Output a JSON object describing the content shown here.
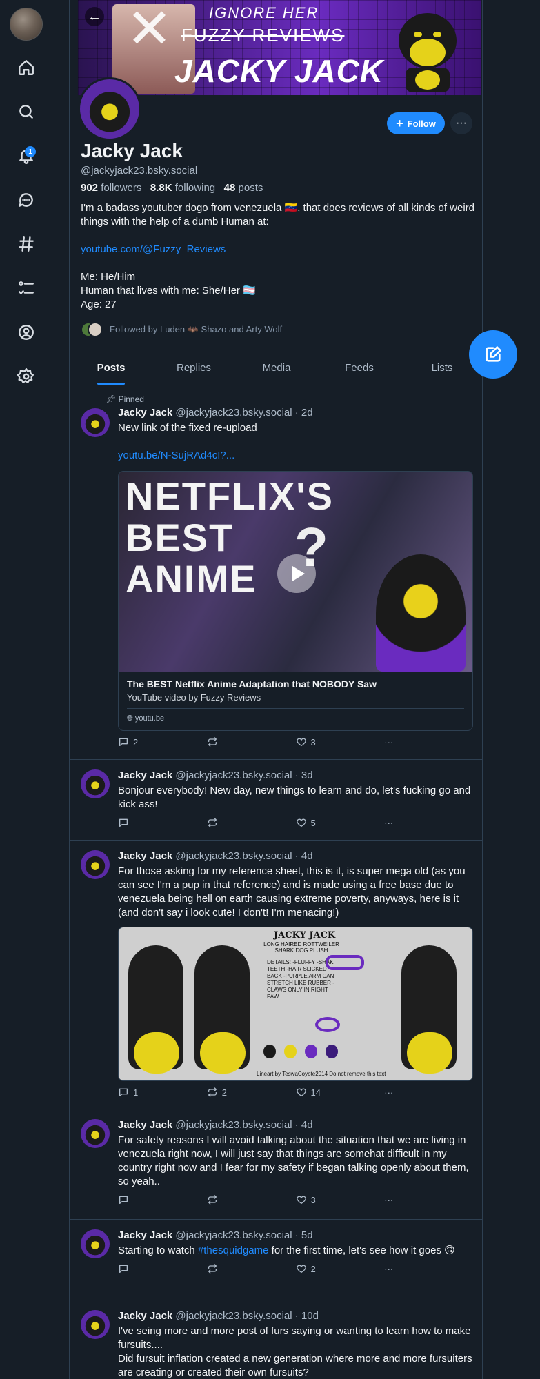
{
  "rail": {
    "notif_count": "1",
    "icons": [
      "home-icon",
      "search-icon",
      "bell-icon",
      "chat-icon",
      "hashtag-icon",
      "list-icon",
      "profile-icon",
      "settings-icon"
    ]
  },
  "banner": {
    "line1": "IGNORE HER",
    "line2": "FUZZY REVIEWS",
    "line3": "JACKY JACK"
  },
  "profile": {
    "name": "Jacky Jack",
    "handle": "@jackyjack23.bsky.social",
    "followers_count": "902",
    "followers_label": " followers",
    "following_count": "8.8K",
    "following_label": " following",
    "posts_count": "48",
    "posts_label": " posts",
    "follow_label": "Follow",
    "bio_line1": "I'm a badass youtuber dogo from venezuela 🇻🇪, that does reviews of all kinds of weird things with the help of a dumb Human at:",
    "bio_link": "youtube.com/@Fuzzy_Reviews",
    "bio_line2": "Me: He/Him",
    "bio_line3": "Human that lives with me: She/Her 🏳️‍⚧️",
    "bio_line4": "Age: 27",
    "followed_by": "Followed by Luden 🦇 Shazo and Arty Wolf"
  },
  "tabs": [
    "Posts",
    "Replies",
    "Media",
    "Feeds",
    "Lists"
  ],
  "accent": "#208bfe",
  "posts": [
    {
      "pinned": "Pinned",
      "author": "Jacky Jack",
      "meta": " @jackyjack23.bsky.social · 2d",
      "text": "New link of the fixed re-upload",
      "link": "youtu.be/N-SujRAd4cI?...",
      "embed_title": "The BEST Netflix Anime Adaptation that NOBODY Saw",
      "embed_desc": "YouTube video by Fuzzy Reviews",
      "embed_domain": "youtu.be",
      "thumb_text": "NETFLIX'S BEST ANIME",
      "replies": "2",
      "reposts": "",
      "likes": "3"
    },
    {
      "author": "Jacky Jack",
      "meta": " @jackyjack23.bsky.social · 3d",
      "text": "Bonjour everybody! New day, new things to learn and do, let's fucking go and kick ass!",
      "replies": "",
      "reposts": "",
      "likes": "5"
    },
    {
      "author": "Jacky Jack",
      "meta": " @jackyjack23.bsky.social · 4d",
      "text": "For those asking for my reference sheet, this is it, is super mega old (as you can see I'm a pup in that reference) and is made using a free base due to venezuela being hell on earth causing extreme poverty, anyways, here is it (and don't say i look cute! I don't! I'm menacing!)",
      "ref_title": "JACKY JACK",
      "ref_sub": "LONG HAIRED ROTTWEILER SHARK DOG PLUSH",
      "ref_details": "DETAILS: -FLUFFY -SHAK TEETH -HAIR SLICKED BACK -PURPLE ARM CAN STRETCH LIKE RUBBER -CLAWS ONLY IN RIGHT PAW",
      "ref_credit": "Lineart by TeswaCoyote2014 Do not remove this text",
      "replies": "1",
      "reposts": "2",
      "likes": "14"
    },
    {
      "author": "Jacky Jack",
      "meta": " @jackyjack23.bsky.social · 4d",
      "text": "For safety reasons I will avoid talking about the situation that we are living in venezuela right now,  I will just say that things are somehat difficult in my country right now and I fear for my safety if began talking openly about them, so yeah..",
      "replies": "",
      "reposts": "",
      "likes": "3"
    },
    {
      "author": "Jacky Jack",
      "meta": " @jackyjack23.bsky.social · 5d",
      "text_pre": "Starting to watch ",
      "hashtag": "#thesquidgame",
      "text_post": " for the first time, let's see how it goes 🙃",
      "replies": "",
      "reposts": "",
      "likes": "2"
    },
    {
      "author": "Jacky Jack",
      "meta": " @jackyjack23.bsky.social · 10d",
      "text": "I've seing more and more post of furs saying or wanting to learn how to make fursuits....",
      "text2": "Did fursuit inflation created a new generation where more and more fursuiters are creating or created their own fursuits?"
    }
  ]
}
